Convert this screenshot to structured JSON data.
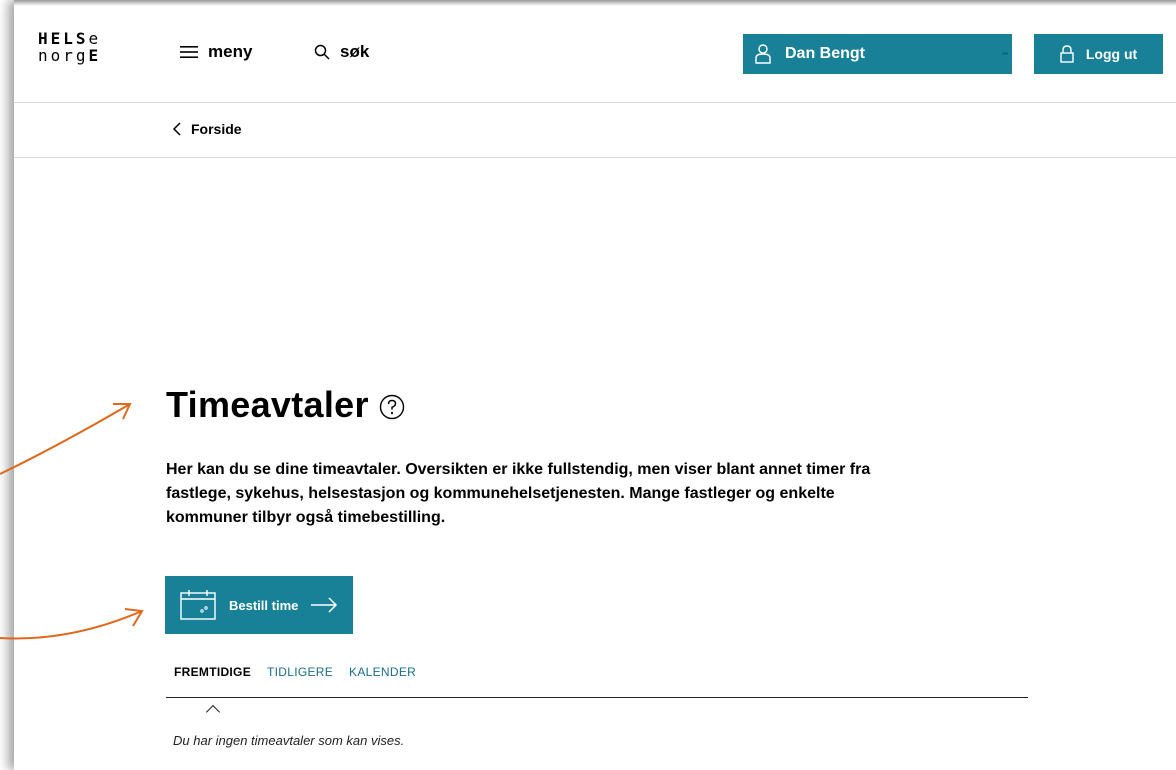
{
  "logo": {
    "line1": "HELSe",
    "line2": "norgE",
    "l1_bold": "HELS",
    "l1_rest": "e",
    "l2_light": "norg",
    "l2_bold": "E"
  },
  "header": {
    "menu_label": "meny",
    "search_label": "søk",
    "user_name": "Dan Bengt",
    "logout_label": "Logg ut"
  },
  "breadcrumb": {
    "label": "Forside"
  },
  "main": {
    "title": "Timeavtaler",
    "intro": "Her kan du se dine timeavtaler. Oversikten er ikke fullstendig, men viser blant annet timer fra fastlege, sykehus, helsestasjon og kommunehelsetjenesten. Mange fastleger og enkelte kommuner tilbyr også timebestilling.",
    "order_button": "Bestill time",
    "tabs": [
      {
        "label": "FREMTIDIGE",
        "active": true
      },
      {
        "label": "TIDLIGERE",
        "active": false
      },
      {
        "label": "KALENDER",
        "active": false
      }
    ],
    "empty_message": "Du har ingen timeavtaler som kan vises."
  },
  "colors": {
    "accent": "#188097",
    "annotation_arrow": "#e0671c"
  }
}
